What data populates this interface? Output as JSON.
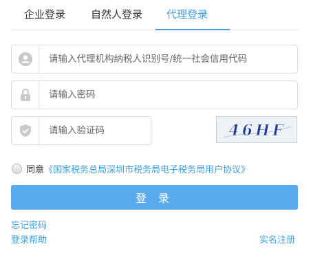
{
  "tabs": [
    {
      "label": "企业登录"
    },
    {
      "label": "自然人登录"
    },
    {
      "label": "代理登录",
      "active": true
    }
  ],
  "form": {
    "username": {
      "placeholder": "请输入代理机构纳税人识别号/统一社会信用代码",
      "value": "",
      "icon": "user-icon"
    },
    "password": {
      "placeholder": "请输入密码",
      "value": "",
      "icon": "lock-icon"
    },
    "captcha": {
      "placeholder": "请输入验证码",
      "value": "",
      "icon": "shield-icon",
      "image_text": "46HF"
    }
  },
  "agreement": {
    "checked": false,
    "label": "同意",
    "link": "《国家税务总局深圳市税务局电子税务局用户协议》"
  },
  "login_button": {
    "label": "登 录"
  },
  "links": {
    "forgot_password": "忘记密码",
    "login_help": "登录帮助",
    "register": "实名注册"
  },
  "colors": {
    "accent": "#3ba0e6",
    "button": "#5aaaf0",
    "icon": "#c9c9c9",
    "captcha_text": "#1f3d9c"
  }
}
